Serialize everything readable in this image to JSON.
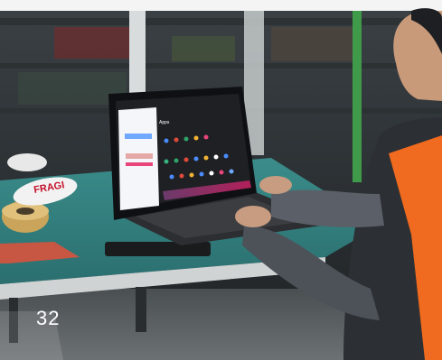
{
  "photo": {
    "tape_label": "FRAGI",
    "page_number": "32"
  },
  "screen": {
    "apps_heading": "Apps",
    "colors": {
      "accent": "#e8457a",
      "selection": "#6fa8ff",
      "vest": "#f06a1f"
    }
  }
}
